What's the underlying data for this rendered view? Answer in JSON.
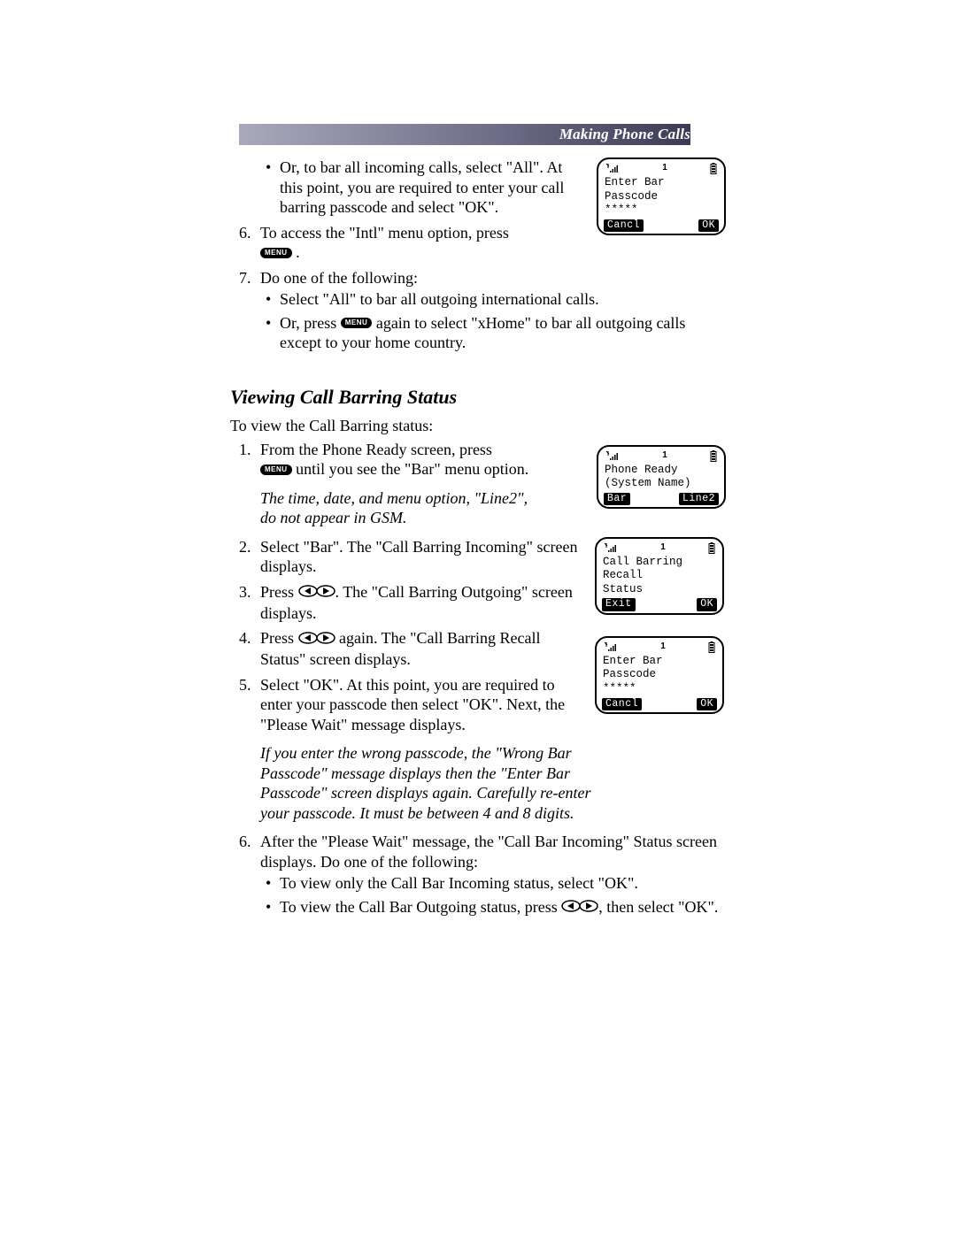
{
  "header": {
    "title": "Making Phone Calls"
  },
  "icons": {
    "menu_label": "MENU"
  },
  "section1": {
    "bullet_all": "Or, to bar all incoming calls, select \"All\". At this point, you are required to enter your call barring passcode and select \"OK\".",
    "item6_a": "To access the \"Intl\" menu option, press ",
    "item6_b": ".",
    "item7_lead": "Do one of the following:",
    "item7_b1": "Select \"All\" to bar all outgoing international calls.",
    "item7_b2a": "Or, press ",
    "item7_b2b": " again to select \"xHome\" to bar all outgoing calls except to your home country."
  },
  "section2": {
    "heading": "Viewing Call Barring Status",
    "intro": "To view the Call Barring status:",
    "step1_a": "From the Phone Ready screen, press ",
    "step1_b": " until you see the \"Bar\" menu option.",
    "note1": "The time, date, and menu option, \"Line2\", do not appear in GSM.",
    "step2": "Select \"Bar\". The \"Call Barring Incoming\" screen displays.",
    "step3_a": "Press ",
    "step3_b": ". The \"Call Barring Outgoing\" screen displays.",
    "step4_a": "Press ",
    "step4_b": " again. The \"Call Barring Recall Status\" screen displays.",
    "step5": "Select \"OK\". At this point, you are required to enter your passcode then select \"OK\". Next, the \"Please Wait\" message displays.",
    "note2": "If you enter the wrong passcode, the \"Wrong Bar Passcode\" message displays then the \"Enter Bar Passcode\" screen displays again. Carefully re-enter your passcode. It must be between 4 and 8 digits.",
    "step6_lead": "After the \"Please Wait\" message, the \"Call Bar Incoming\" Status screen displays. Do one of the following:",
    "step6_b1": "To view only the Call Bar Incoming status, select \"OK\".",
    "step6_b2a": "To view the Call Bar Outgoing status, press ",
    "step6_b2b": ", then select \"OK\"."
  },
  "phones": {
    "p1": {
      "num": "1",
      "line1": "Enter Bar",
      "line2": "Passcode",
      "line3": "*****",
      "sk_left": "Cancl",
      "sk_right": "OK"
    },
    "p2": {
      "num": "1",
      "line1": "Phone Ready",
      "line2": "(System Name)",
      "line3": "",
      "sk_left": "Bar",
      "sk_right": "Line2"
    },
    "p3": {
      "num": "1",
      "line1": "Call Barring",
      "line2": "Recall",
      "line3": "Status",
      "sk_left": "Exit",
      "sk_right": "OK"
    },
    "p4": {
      "num": "1",
      "line1": "Enter Bar",
      "line2": "Passcode",
      "line3": "*****",
      "sk_left": "Cancl",
      "sk_right": "OK"
    }
  }
}
